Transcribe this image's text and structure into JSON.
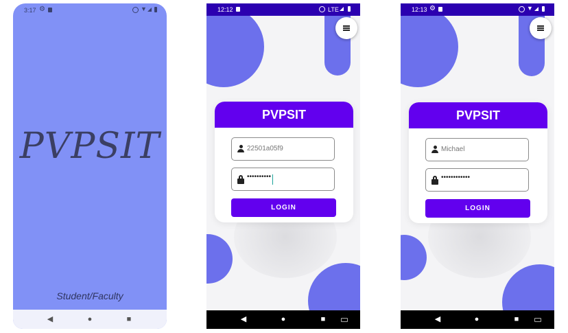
{
  "splash": {
    "status_time": "3:17",
    "title": "PVPSIT",
    "subtitle": "Student/Faculty"
  },
  "login_a": {
    "status_time": "12:12",
    "network": "LTE",
    "header": "PVPSIT",
    "username_value": "22501a05f9",
    "password_value": "••••••••••",
    "login_label": "LOGIN"
  },
  "login_b": {
    "status_time": "12:13",
    "header": "PVPSIT",
    "username_value": "Michael",
    "password_value": "••••••••••••",
    "login_label": "LOGIN"
  },
  "icons": {
    "menu": "hamburger-menu-icon",
    "user": "person-icon",
    "lock": "lock-icon",
    "nav_back": "back-triangle-icon",
    "nav_home": "home-circle-icon",
    "nav_recents": "recents-square-icon",
    "keyboard": "keyboard-icon"
  },
  "colors": {
    "splash_bg": "#8191f6",
    "accent": "#6200ee",
    "blob": "#6c70ec",
    "status_bar": "#2b00b0"
  }
}
